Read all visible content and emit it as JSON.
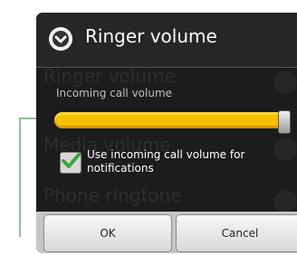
{
  "dialog": {
    "title": "Ringer volume",
    "slider": {
      "label": "Incoming call volume",
      "value_fraction": 0.97
    },
    "checkbox": {
      "label": "Use incoming call volume for notifications",
      "checked": true
    },
    "buttons": {
      "ok": "OK",
      "cancel": "Cancel"
    }
  },
  "background_items": [
    "Ringer volume",
    "Media volume",
    "Phone ringtone"
  ],
  "colors": {
    "slider_fill": "#f4c200",
    "checkbox_check": "#3aa63a",
    "leader_line": "#8fc098"
  },
  "icons": {
    "title": "chevron-down-icon",
    "check": "check-icon"
  }
}
